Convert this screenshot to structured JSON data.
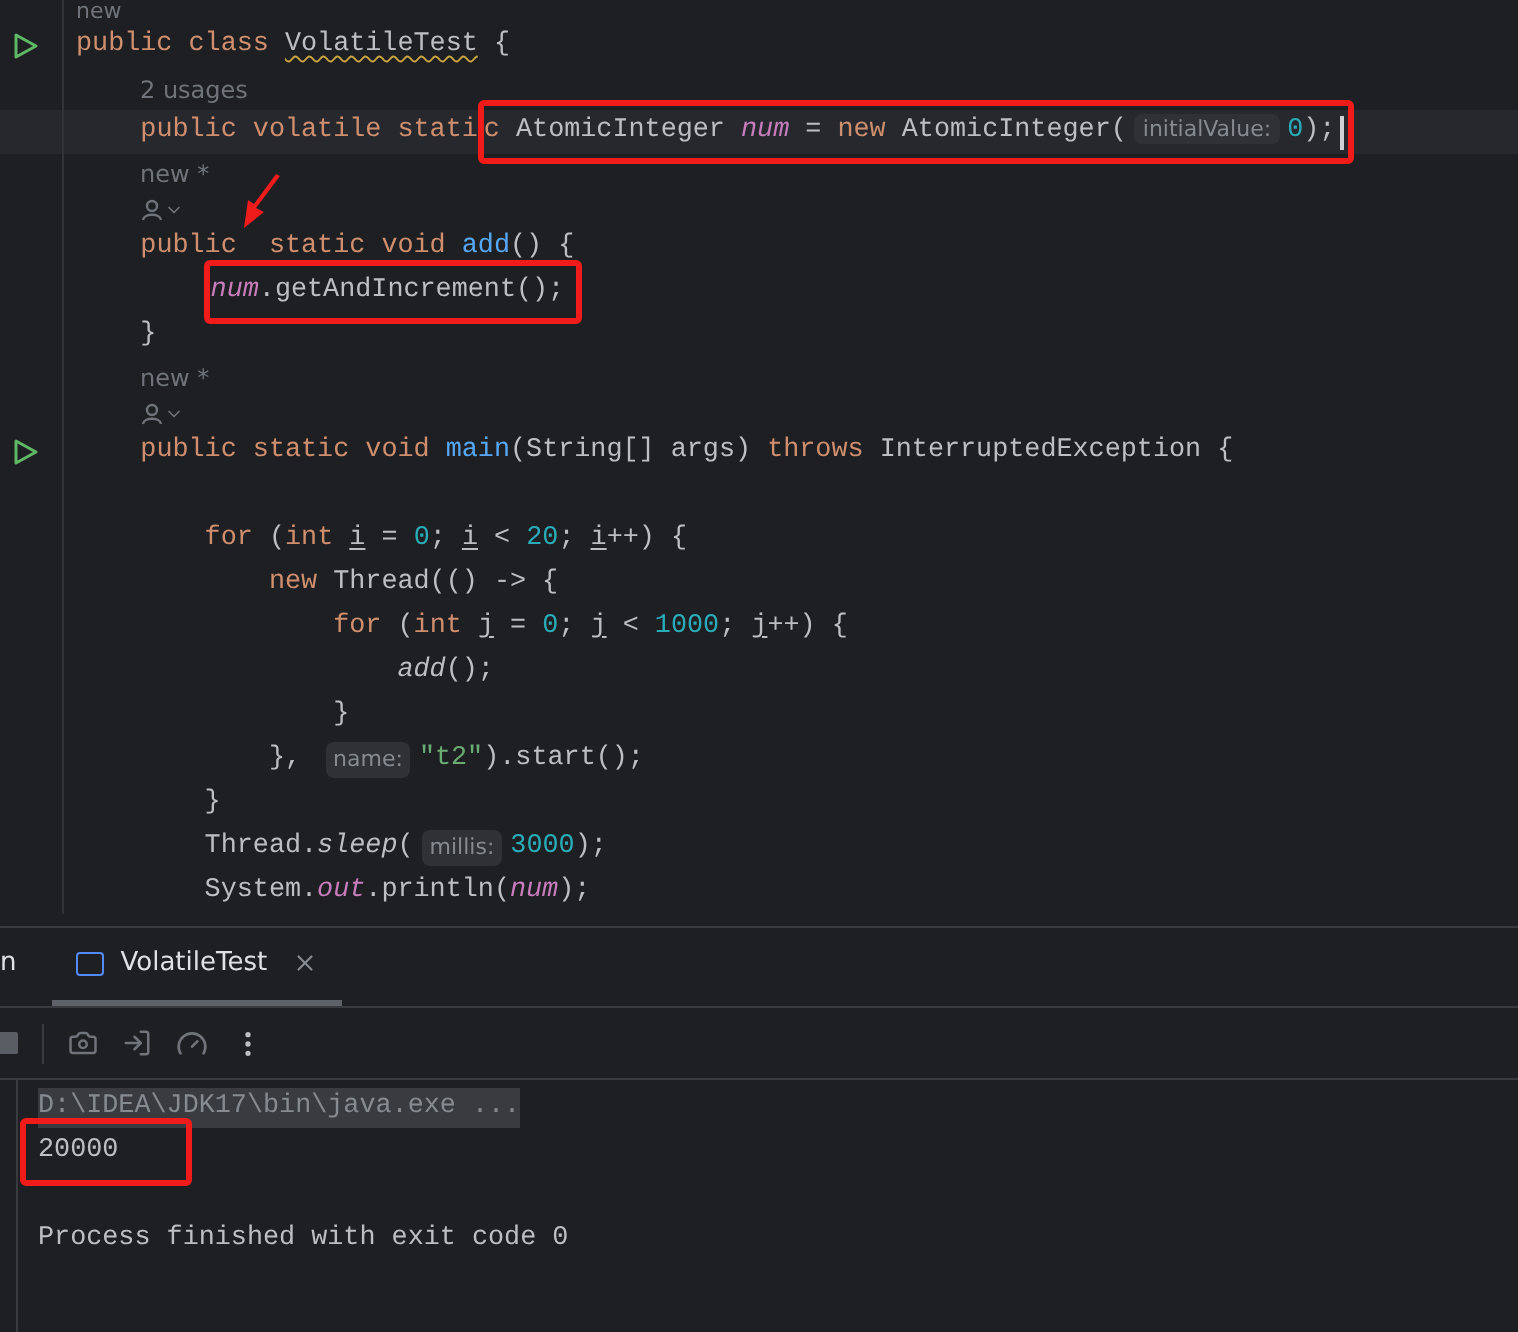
{
  "editor": {
    "lines": [
      {
        "kind": "author_top",
        "text": "new"
      },
      {
        "kind": "code",
        "run": true,
        "tokens": [
          {
            "kind": "keyword",
            "text": "public class "
          },
          {
            "kind": "warning",
            "text": "VolatileTest"
          },
          {
            "kind": "text",
            "text": " {"
          }
        ]
      },
      {
        "kind": "usages",
        "text": "2 usages"
      },
      {
        "kind": "code",
        "current": true,
        "caret": true,
        "tokens": [
          {
            "kind": "keyword",
            "text": "    public volatile stati"
          },
          {
            "kind": "box",
            "tokens": [
              {
                "kind": "keyword",
                "text": "c"
              },
              {
                "kind": "text",
                "text": " AtomicInteger "
              },
              {
                "kind": "field",
                "text": "num"
              },
              {
                "kind": "text",
                "text": " = "
              },
              {
                "kind": "keyword",
                "text": "new"
              },
              {
                "kind": "text",
                "text": " AtomicInteger("
              },
              {
                "kind": "hint",
                "text": "initialValue:"
              },
              {
                "kind": "number",
                "text": "0"
              },
              {
                "kind": "text",
                "text": ");"
              }
            ]
          }
        ]
      },
      {
        "kind": "author",
        "text": "new *"
      },
      {
        "kind": "author_icon"
      },
      {
        "kind": "code",
        "tokens": [
          {
            "kind": "keyword",
            "text": "    public  static void "
          },
          {
            "kind": "method",
            "text": "add"
          },
          {
            "kind": "text",
            "text": "() {"
          }
        ]
      },
      {
        "kind": "code",
        "tokens": [
          {
            "kind": "box",
            "tokens": [
              {
                "kind": "field",
                "text": "        num"
              },
              {
                "kind": "text",
                "text": ".getAndIncrement();"
              }
            ]
          }
        ]
      },
      {
        "kind": "code",
        "tokens": [
          {
            "kind": "text",
            "text": "    }"
          }
        ]
      },
      {
        "kind": "author",
        "text": "new *"
      },
      {
        "kind": "author_icon"
      },
      {
        "kind": "code",
        "run": true,
        "tokens": [
          {
            "kind": "keyword",
            "text": "    public static void "
          },
          {
            "kind": "method",
            "text": "main"
          },
          {
            "kind": "text",
            "text": "(String[] args) "
          },
          {
            "kind": "keyword",
            "text": "throws"
          },
          {
            "kind": "text",
            "text": " InterruptedException {"
          }
        ]
      },
      {
        "kind": "blank"
      },
      {
        "kind": "code",
        "tokens": [
          {
            "kind": "keyword",
            "text": "        for"
          },
          {
            "kind": "text",
            "text": " ("
          },
          {
            "kind": "keyword",
            "text": "int "
          },
          {
            "kind": "variable",
            "text": "i"
          },
          {
            "kind": "text",
            "text": " = "
          },
          {
            "kind": "number",
            "text": "0"
          },
          {
            "kind": "text",
            "text": "; "
          },
          {
            "kind": "variable",
            "text": "i"
          },
          {
            "kind": "text",
            "text": " < "
          },
          {
            "kind": "number",
            "text": "20"
          },
          {
            "kind": "text",
            "text": "; "
          },
          {
            "kind": "variable",
            "text": "i"
          },
          {
            "kind": "text",
            "text": "++) {"
          }
        ]
      },
      {
        "kind": "code",
        "tokens": [
          {
            "kind": "keyword",
            "text": "            new"
          },
          {
            "kind": "text",
            "text": " Thread(() -> {"
          }
        ]
      },
      {
        "kind": "code",
        "tokens": [
          {
            "kind": "keyword",
            "text": "                for"
          },
          {
            "kind": "text",
            "text": " ("
          },
          {
            "kind": "keyword",
            "text": "int "
          },
          {
            "kind": "variable",
            "text": "j"
          },
          {
            "kind": "text",
            "text": " = "
          },
          {
            "kind": "number",
            "text": "0"
          },
          {
            "kind": "text",
            "text": "; "
          },
          {
            "kind": "variable",
            "text": "j"
          },
          {
            "kind": "text",
            "text": " < "
          },
          {
            "kind": "number",
            "text": "1000"
          },
          {
            "kind": "text",
            "text": "; "
          },
          {
            "kind": "variable",
            "text": "j"
          },
          {
            "kind": "text",
            "text": "++) {"
          }
        ]
      },
      {
        "kind": "code",
        "tokens": [
          {
            "kind": "italic",
            "text": "                    add"
          },
          {
            "kind": "text",
            "text": "();"
          }
        ]
      },
      {
        "kind": "code",
        "tokens": [
          {
            "kind": "text",
            "text": "                }"
          }
        ]
      },
      {
        "kind": "code",
        "tokens": [
          {
            "kind": "text",
            "text": "            }, "
          },
          {
            "kind": "hint",
            "text": "name:"
          },
          {
            "kind": "string",
            "text": "\"t2\""
          },
          {
            "kind": "text",
            "text": ").start();"
          }
        ]
      },
      {
        "kind": "code",
        "tokens": [
          {
            "kind": "text",
            "text": "        }"
          }
        ]
      },
      {
        "kind": "code",
        "tokens": [
          {
            "kind": "text",
            "text": "        Thread."
          },
          {
            "kind": "italic",
            "text": "sleep"
          },
          {
            "kind": "text",
            "text": "("
          },
          {
            "kind": "hint",
            "text": "millis:"
          },
          {
            "kind": "number",
            "text": "3000"
          },
          {
            "kind": "text",
            "text": ");"
          }
        ]
      },
      {
        "kind": "code",
        "tokens": [
          {
            "kind": "text",
            "text": "        System."
          },
          {
            "kind": "field",
            "text": "out"
          },
          {
            "kind": "text",
            "text": ".println("
          },
          {
            "kind": "field",
            "text": "num"
          },
          {
            "kind": "text",
            "text": ");"
          }
        ]
      }
    ]
  },
  "run_panel": {
    "tabs": [
      {
        "label": "n",
        "selected": false,
        "closable": false
      },
      {
        "label": "VolatileTest",
        "selected": true,
        "closable": true
      }
    ],
    "console": [
      {
        "kind": "command",
        "text": "D:\\IDEA\\JDK17\\bin\\java.exe ..."
      },
      {
        "kind": "output",
        "text": "20000",
        "boxed": true
      },
      {
        "kind": "blank"
      },
      {
        "kind": "output",
        "text": "Process finished with exit code 0",
        "boxed": false
      }
    ]
  }
}
